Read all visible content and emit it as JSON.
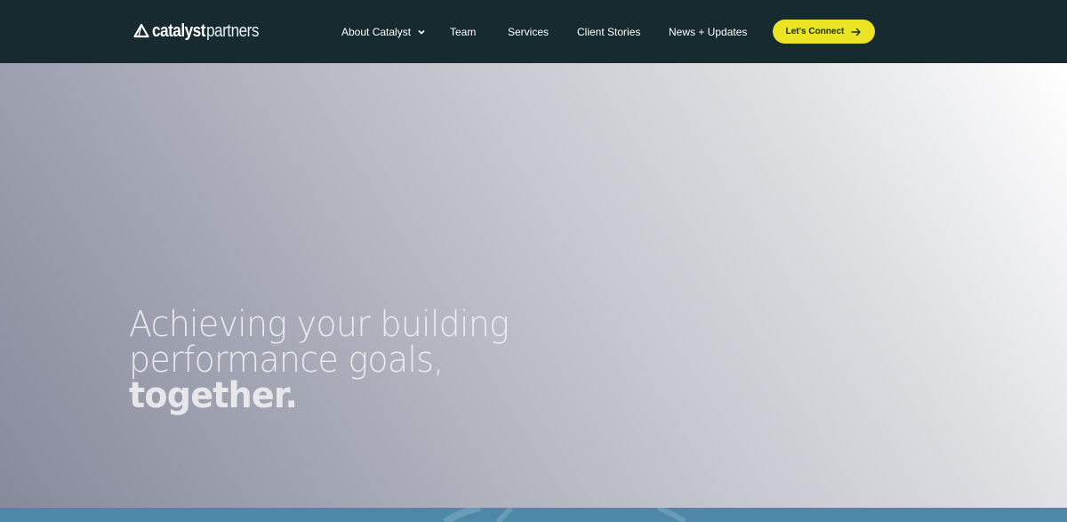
{
  "brand": {
    "logo_icon": "catalyst-triangle-icon",
    "name_bold": "catalyst",
    "name_light": "partners",
    "colors": {
      "header_bg": "#172a30",
      "accent": "#eae424",
      "strip": "#4e88a8"
    }
  },
  "nav": {
    "items": [
      {
        "label": "About Catalyst",
        "has_dropdown": true
      },
      {
        "label": "Team"
      },
      {
        "label": "Services"
      },
      {
        "label": "Client Stories"
      },
      {
        "label": "News + Updates"
      }
    ],
    "cta_label": "Let's Connect",
    "cta_icon": "arrow-right-icon"
  },
  "hero": {
    "line1": "Achieving your building",
    "line2": "performance goals,",
    "line3": "together."
  }
}
